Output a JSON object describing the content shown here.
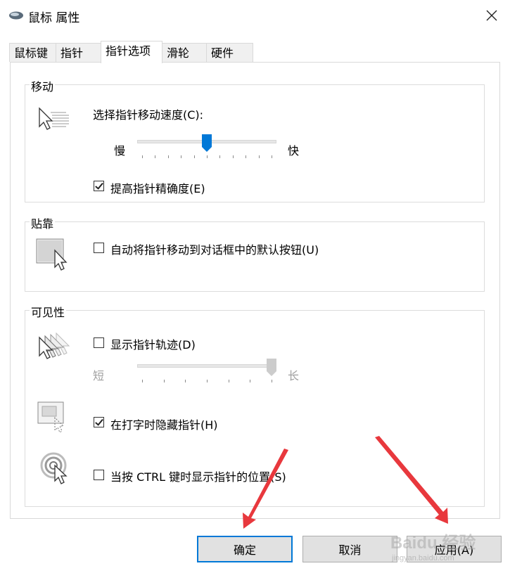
{
  "window": {
    "title": "鼠标 属性",
    "icon": "mouse-icon"
  },
  "tabs": [
    {
      "label": "鼠标键",
      "active": false
    },
    {
      "label": "指针",
      "active": false
    },
    {
      "label": "指针选项",
      "active": true
    },
    {
      "label": "滑轮",
      "active": false
    },
    {
      "label": "硬件",
      "active": false
    }
  ],
  "motion": {
    "group_label": "移动",
    "speed_label": "选择指针移动速度(C):",
    "slow_label": "慢",
    "fast_label": "快",
    "speed_level": 0.5,
    "precision_label": "提高指针精确度(E)",
    "precision_checked": true
  },
  "snap": {
    "group_label": "贴靠",
    "snap_label": "自动将指针移动到对话框中的默认按钮(U)",
    "snap_checked": false
  },
  "visibility": {
    "group_label": "可见性",
    "trails_label": "显示指针轨迹(D)",
    "trails_checked": false,
    "short_label": "短",
    "long_label": "长",
    "trail_length_level": 1.0,
    "hide_typing_label": "在打字时隐藏指针(H)",
    "hide_typing_checked": true,
    "ctrl_label": "当按 CTRL 键时显示指针的位置(S)",
    "ctrl_checked": false
  },
  "buttons": {
    "ok": "确定",
    "cancel": "取消",
    "apply": "应用(A)"
  },
  "colors": {
    "accent": "#0078d7",
    "arrow": "#e8383d"
  },
  "watermark": {
    "brand": "Baidu 经验",
    "site": "jingyan.baidu.com"
  }
}
